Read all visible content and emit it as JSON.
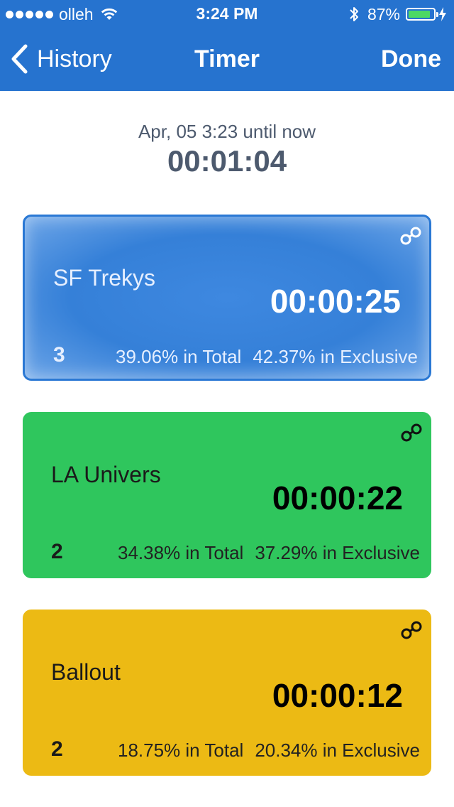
{
  "status_bar": {
    "carrier": "olleh",
    "time": "3:24 PM",
    "battery_percent": "87%",
    "battery_level": 0.87,
    "icons": [
      "signal-dots",
      "wifi-icon",
      "bluetooth-icon",
      "battery-icon",
      "charging-bolt-icon"
    ]
  },
  "nav": {
    "back_label": "History",
    "title": "Timer",
    "done_label": "Done"
  },
  "summary": {
    "range": "Apr, 05 3:23 until now",
    "total": "00:01:04"
  },
  "timers": [
    {
      "name": "SF Trekys",
      "time": "00:00:25",
      "count": "3",
      "pct_total": "39.06% in Total",
      "pct_exclusive": "42.37% in Exclusive",
      "color": "#3580d8",
      "selected": true
    },
    {
      "name": "LA Univers",
      "time": "00:00:22",
      "count": "2",
      "pct_total": "34.38% in Total",
      "pct_exclusive": "37.29% in Exclusive",
      "color": "#2fc65d",
      "selected": false
    },
    {
      "name": "Ballout",
      "time": "00:00:12",
      "count": "2",
      "pct_total": "18.75% in Total",
      "pct_exclusive": "20.34% in Exclusive",
      "color": "#ecba14",
      "selected": false
    }
  ],
  "colors": {
    "nav_background": "#2673cf",
    "summary_text": "#4d5a6e",
    "battery_fill": "#4cd964"
  }
}
